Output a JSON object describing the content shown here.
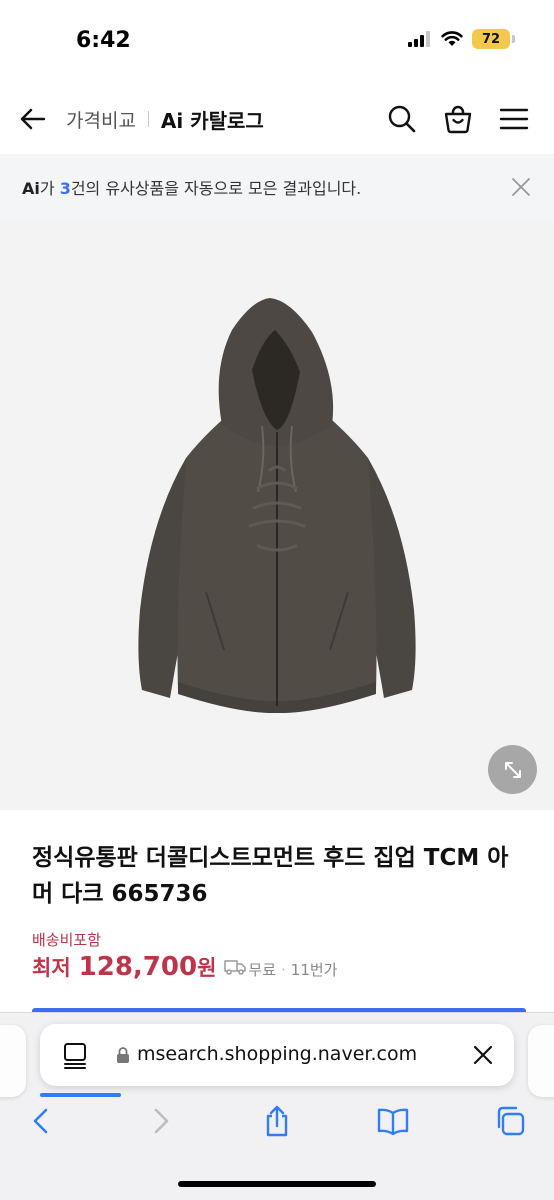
{
  "status_bar": {
    "time": "6:42",
    "battery_level": "72",
    "icons": [
      "signal-icon",
      "wifi-icon",
      "battery-icon"
    ]
  },
  "header": {
    "breadcrumb_compare": "가격비교",
    "breadcrumb_catalog": "Ai 카탈로그",
    "icons": [
      "back-arrow-icon",
      "search-icon",
      "cart-bag-icon",
      "menu-icon"
    ]
  },
  "ai_banner": {
    "ai_label": "Ai",
    "text_before_count": "가 ",
    "count": "3",
    "text_after_count": "건의 유사상품을 자동으로 모은 결과입니다.",
    "close_icon": "close-icon"
  },
  "product": {
    "image_subject": "hoodie-image",
    "expand_icon": "expand-arrows-icon",
    "title": "정식유통판 더콜디스트모먼트 후드 집업 TCM 아머 다크 665736",
    "shipping_label": "배송비포함",
    "price_lowest_label": "최저",
    "price_value": "128,700",
    "price_unit": "원",
    "delivery_icon": "truck-icon",
    "delivery_fee": "무료",
    "separator": "·",
    "seller_count": "11번가"
  },
  "browser": {
    "url": "msearch.shopping.naver.com",
    "icons": [
      "reader-mode-icon",
      "lock-icon",
      "stop-loading-icon",
      "back-chevron-icon",
      "forward-chevron-icon",
      "share-icon",
      "bookmarks-icon",
      "tabs-icon"
    ],
    "load_progress": 0.17
  },
  "colors": {
    "accent_blue": "#3b6ef0",
    "price_red": "#c0344a",
    "battery_yellow": "#f2c94c",
    "browser_blue": "#2f7ef5"
  }
}
